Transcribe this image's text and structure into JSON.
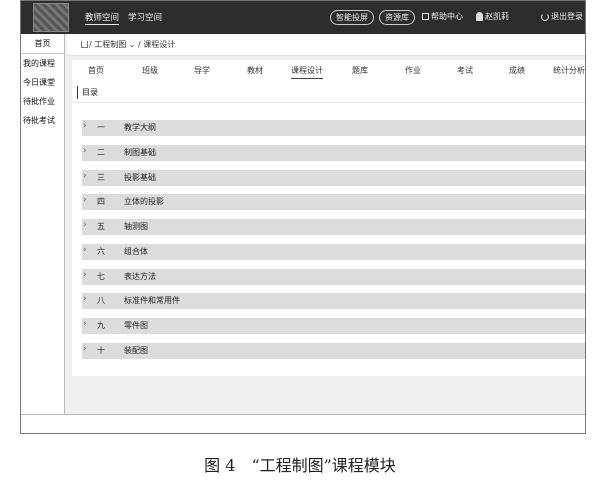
{
  "topbar": {
    "nav": [
      "教师空间",
      "学习空间"
    ],
    "pills": [
      "智能投屏",
      "资源库"
    ],
    "help": "帮助中心",
    "user": "赵凯莉",
    "logout": "退出登录"
  },
  "sidebar": {
    "items": [
      "首页",
      "我的课程",
      "今日课堂",
      "待批作业",
      "待批考试"
    ]
  },
  "breadcrumb": {
    "path": "/ 工程制图 ⌄ / 课程设计"
  },
  "tabs": [
    "首页",
    "班级",
    "导学",
    "教材",
    "课程设计",
    "题库",
    "作业",
    "考试",
    "成绩",
    "统计分析"
  ],
  "toc": {
    "label": "目录",
    "chapters": [
      {
        "num": "一",
        "title": "教学大纲"
      },
      {
        "num": "二",
        "title": "制图基础"
      },
      {
        "num": "三",
        "title": "投影基础"
      },
      {
        "num": "四",
        "title": "立体的投影"
      },
      {
        "num": "五",
        "title": "轴测图"
      },
      {
        "num": "六",
        "title": "组合体"
      },
      {
        "num": "七",
        "title": "表达方法"
      },
      {
        "num": "八",
        "title": "标准件和常用件"
      },
      {
        "num": "九",
        "title": "零件图"
      },
      {
        "num": "十",
        "title": "装配图"
      }
    ]
  },
  "caption": "图 4　“工程制图”课程模块"
}
